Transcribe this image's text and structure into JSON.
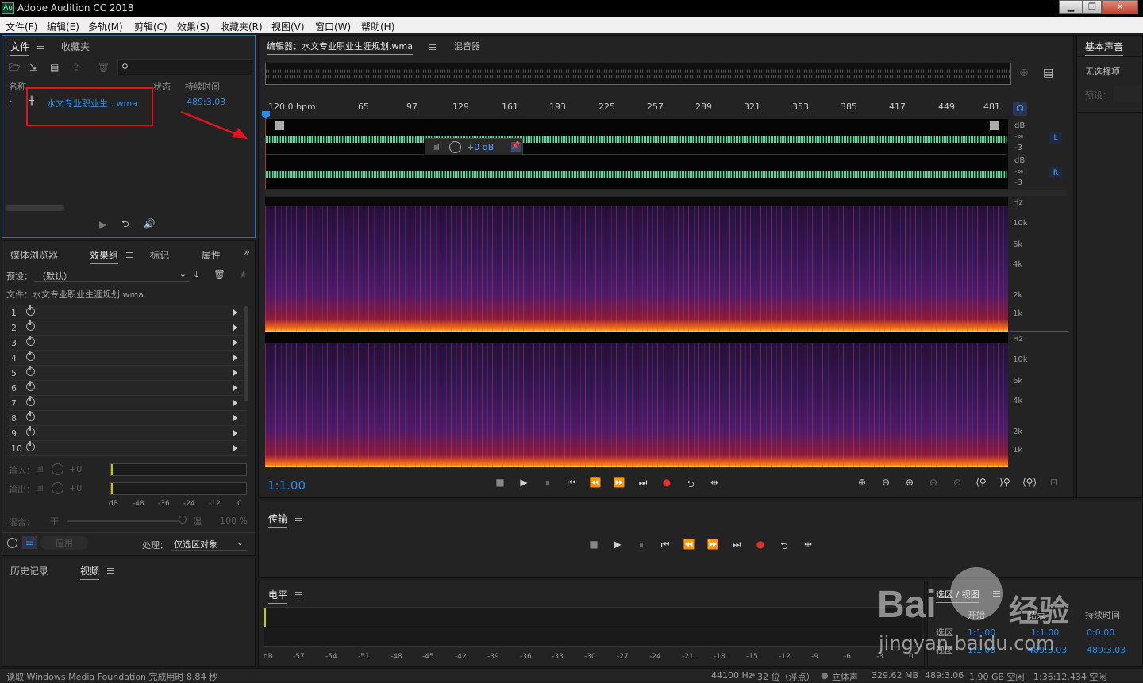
{
  "app": {
    "title": "Adobe Audition CC 2018",
    "logo": "Au"
  },
  "menu": [
    "文件(F)",
    "编辑(E)",
    "多轨(M)",
    "剪辑(C)",
    "效果(S)",
    "收藏夹(R)",
    "视图(V)",
    "窗口(W)",
    "帮助(H)"
  ],
  "files_panel": {
    "tabs": [
      "文件",
      "收藏夹"
    ],
    "columns": {
      "name": "名称",
      "status": "状态",
      "duration": "持续时间"
    },
    "file": {
      "name": "水文专业职业生 ..wma",
      "duration": "489:3.03"
    }
  },
  "effects_panel": {
    "tabs": [
      "媒体浏览器",
      "效果组",
      "标记",
      "属性"
    ],
    "preset_label": "预设：",
    "preset_value": "（默认）",
    "file_label": "文件：水文专业职业生涯规划.wma",
    "slots": [
      "1",
      "2",
      "3",
      "4",
      "5",
      "6",
      "7",
      "8",
      "9",
      "10"
    ],
    "input_label": "输入：",
    "output_label": "输出：",
    "input_db": "+0",
    "output_db": "+0",
    "meter_scale": [
      "dB",
      "-48",
      "-36",
      "-24",
      "-12",
      "0"
    ],
    "mix_label": "混合：",
    "mix_dry": "干",
    "mix_wet": "湿",
    "mix_percent": "100 %",
    "apply_label": "应用",
    "process_label": "处理：",
    "process_value": "仅选区对象"
  },
  "history_panel": {
    "tabs": [
      "历史记录",
      "视频"
    ]
  },
  "editor": {
    "tab_label": "编辑器：水文专业职业生涯规划.wma",
    "mixer_tab": "混音器",
    "ruler": [
      "120.0 bpm",
      "65",
      "97",
      "129",
      "161",
      "193",
      "225",
      "257",
      "289",
      "321",
      "353",
      "385",
      "417",
      "449",
      "481"
    ],
    "hud_gain": "+0 dB",
    "db_labels_top": [
      "dB",
      "-∞",
      "-3"
    ],
    "db_labels_bot": [
      "dB",
      "-∞",
      "-3"
    ],
    "ch_left": "L",
    "ch_right": "R",
    "hz_labels": [
      "Hz",
      "10k",
      "6k",
      "4k",
      "2k",
      "1k"
    ],
    "zoom": "1:1.00"
  },
  "transport_panel": {
    "title": "传输"
  },
  "level_panel": {
    "title": "电平",
    "scale": [
      "dB",
      "-57",
      "-54",
      "-51",
      "-48",
      "-45",
      "-42",
      "-39",
      "-36",
      "-33",
      "-30",
      "-27",
      "-24",
      "-21",
      "-18",
      "-15",
      "-12",
      "-9",
      "-6",
      "-3",
      "0"
    ]
  },
  "right_panel": {
    "tab": "基本声音",
    "no_selection": "无选择项",
    "preset_label": "预设："
  },
  "selection_panel": {
    "tab": "选区 / 视图",
    "headers": [
      "开始",
      "结束",
      "持续时间"
    ],
    "rows": [
      {
        "label": "选区",
        "start": "1:1.00",
        "end": "1:1.00",
        "duration": "0:0.00"
      },
      {
        "label": "视图",
        "start": "1:1.00",
        "end": "489:3.03",
        "duration": "489:3.03"
      }
    ]
  },
  "watermark": {
    "brand": "Bai",
    "brand2": "经验",
    "url": "jingyan.baidu.com"
  },
  "status_bar": {
    "message": "读取 Windows Media Foundation 完成用时 8.84 秒",
    "sample_rate": "44100 Hz",
    "bit_depth": "32 位（浮点）",
    "channels": "立体声",
    "size": "329.62 MB",
    "duration": "489:3.06",
    "free_space": "1.90 GB 空闲",
    "free_time": "1:36:12.434 空闲"
  },
  "colors": {
    "accent": "#2d8ceb",
    "waveform": "#3fe0a0",
    "record": "#e03030",
    "annotation": "#e0141e"
  }
}
